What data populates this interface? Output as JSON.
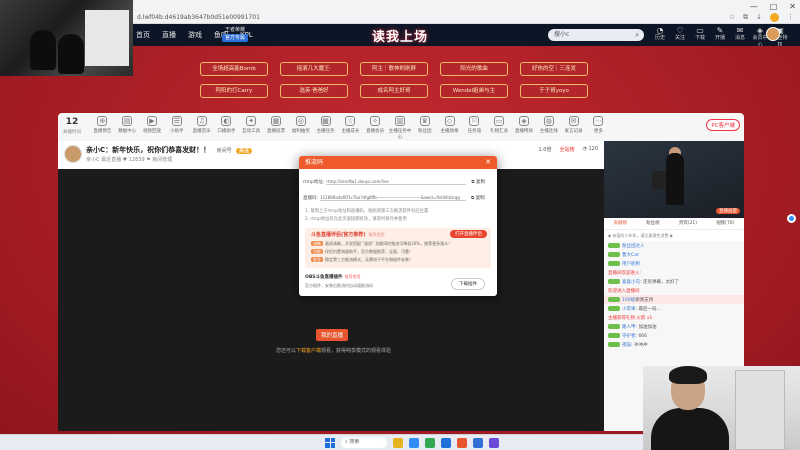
{
  "browser": {
    "address": "d.lwf04b.d4619ab3647b0d51e00991701",
    "controls": [
      "—",
      "□",
      "✕"
    ]
  },
  "site": {
    "nav": [
      "首页",
      "直播",
      "游戏",
      "鱼吧",
      "KPL"
    ],
    "nav_sub_top": "王者荣耀",
    "nav_sub_pill": "官方专属",
    "logo": "读我上场",
    "search_placeholder": "搜小c",
    "header_icons": [
      {
        "glyph": "◔",
        "label": "历史"
      },
      {
        "glyph": "♡",
        "label": "关注"
      },
      {
        "glyph": "▭",
        "label": "下载"
      },
      {
        "glyph": "✎",
        "label": "开播"
      },
      {
        "glyph": "✉",
        "label": "消息"
      },
      {
        "glyph": "◈",
        "label": "会员中心"
      },
      {
        "glyph": "▣",
        "label": "粉丝特权"
      }
    ]
  },
  "gift_buttons": [
    "全场超高能Bomb",
    "摇滚几大魔王·",
    "阿主｜歌神刷刷屏",
    "阳光的歌曲",
    "好热的空｜三连发",
    "阿阳的打Carry",
    "选英·爸爸好",
    "成名阿主好哥",
    "Wendel姐弟与主",
    "于子哥yoyo"
  ],
  "toolbar": {
    "count": "12",
    "count_label": "关播时间",
    "items": [
      {
        "glyph": "⊕",
        "label": "直播预告"
      },
      {
        "glyph": "▤",
        "label": "数据中心"
      },
      {
        "glyph": "▶",
        "label": "视频回放"
      },
      {
        "glyph": "☰",
        "label": "小助手"
      },
      {
        "glyph": "♫",
        "label": "直播音乐"
      },
      {
        "glyph": "◐",
        "label": "口播助手"
      },
      {
        "glyph": "✦",
        "label": "互动工具"
      },
      {
        "glyph": "▦",
        "label": "直播投票"
      },
      {
        "glyph": "◎",
        "label": "福利抽奖"
      },
      {
        "glyph": "▩",
        "label": "主播任务"
      },
      {
        "glyph": "☆",
        "label": "主播成长"
      },
      {
        "glyph": "✧",
        "label": "直播会员"
      },
      {
        "glyph": "▥",
        "label": "主播任务中心"
      },
      {
        "glyph": "♛",
        "label": "粉丝团"
      },
      {
        "glyph": "◇",
        "label": "主播勋章"
      },
      {
        "glyph": "⚐",
        "label": "任务墙"
      },
      {
        "glyph": "▭",
        "label": "礼物汇总"
      },
      {
        "glyph": "◈",
        "label": "直播特效"
      },
      {
        "glyph": "◍",
        "label": "主播连线"
      },
      {
        "glyph": "✉",
        "label": "发言记录"
      },
      {
        "glyph": "⋯",
        "label": "更多"
      }
    ],
    "pc_button": "PC客户端"
  },
  "streamer": {
    "title": "亲小C：新年快乐，祝你们恭喜发财！！",
    "room": "房间号",
    "follow": "关注",
    "meta": "亲小C 最近直播   ♥ 12839   ⚑ 房间管理",
    "right_1": "1.0倍",
    "right_2": "全站榜",
    "right_3": "◔ 120"
  },
  "modal": {
    "title": "推流码",
    "close": "✕",
    "rtmp_label": "rtmp地址:",
    "rtmp_value": "rtmp://sendfw1.douyu.com/live",
    "code_label": "直播码:",
    "code_value": "112889a4af6f1c7ba?dfg8ffb———————————&swid=fkdikfdsirqg",
    "copy": "复制",
    "note1": "1. 复制上方rtmp地址和直播码，粘贴到第三方推流软件对应位置",
    "note2": "2. rtmp地址仅在此页面短期有效，请及时保存并使用",
    "promo_title": "斗鱼直播伴侣(官方推荐)",
    "promo_tag": "推荐使用",
    "promo_btn": "打开直播伴侣",
    "promo_lines": [
      {
        "tag": "流畅",
        "text": "画质清晰，开发搭配 \"画质\" 功能同时推流可降低20%，推荐更多观众！"
      },
      {
        "tag": "功能",
        "text": "伴侣内置海量助手，官方数据推荐，全面、可靠！"
      },
      {
        "tag": "安全",
        "text": "稳定第三方推流模式，无需电子平台和插件安装！"
      }
    ],
    "obs_title": "OBS斗鱼直播插件",
    "obs_tag": "推荐使用",
    "obs_desc": "官方插件，安装后推流时自动填推流码",
    "download": "下载插件"
  },
  "video": {
    "offline_btn": "我的直播",
    "offline_text_pre": "您还可以",
    "offline_text_em": "下载客户端",
    "offline_text_post": "观看，获得纯享模式的观看体验"
  },
  "right_panel": {
    "tag": "直播画面",
    "tabs": [
      "贡献榜",
      "粉丝榜",
      "贵宾(21)",
      "视频(70)"
    ],
    "notice": "◆ 亲爱的小伙伴，请注意理性消费 ◆",
    "chat": [
      {
        "user": "粉丝团达人",
        "text": "",
        "type": "normal"
      },
      {
        "user": "鲁大Cat",
        "text": "",
        "type": "normal"
      },
      {
        "user": "用户昵称",
        "text": "",
        "type": "normal"
      },
      {
        "user": "",
        "text": "直播间欢迎进入:",
        "type": "sys"
      },
      {
        "user": "喜喜小兄",
        "text": ": 还有弹幕，太好了",
        "type": "normal"
      },
      {
        "user": "",
        "text": "欢迎进入直播间",
        "type": "sys"
      },
      {
        "user": "100级",
        "text": "谢谢支持",
        "type": "hl"
      },
      {
        "user": "小苹果",
        "text": ": 最后一局...",
        "type": "normal"
      },
      {
        "user": "",
        "text": "主播获得礼物 火箭 x1",
        "type": "sys"
      },
      {
        "user": "路人甲",
        "text": ": 加油加油",
        "type": "normal"
      },
      {
        "user": "守护者",
        "text": ": 666",
        "type": "normal"
      },
      {
        "user": "夜猫",
        "text": ": 冲冲冲",
        "type": "normal"
      }
    ]
  },
  "taskbar": {
    "search": "搜索",
    "apps": [
      "#e8b320",
      "#2f8df5",
      "#33a852",
      "#1e6fd9",
      "#e8542e",
      "#2f6fd6",
      "#6b48d6"
    ]
  }
}
